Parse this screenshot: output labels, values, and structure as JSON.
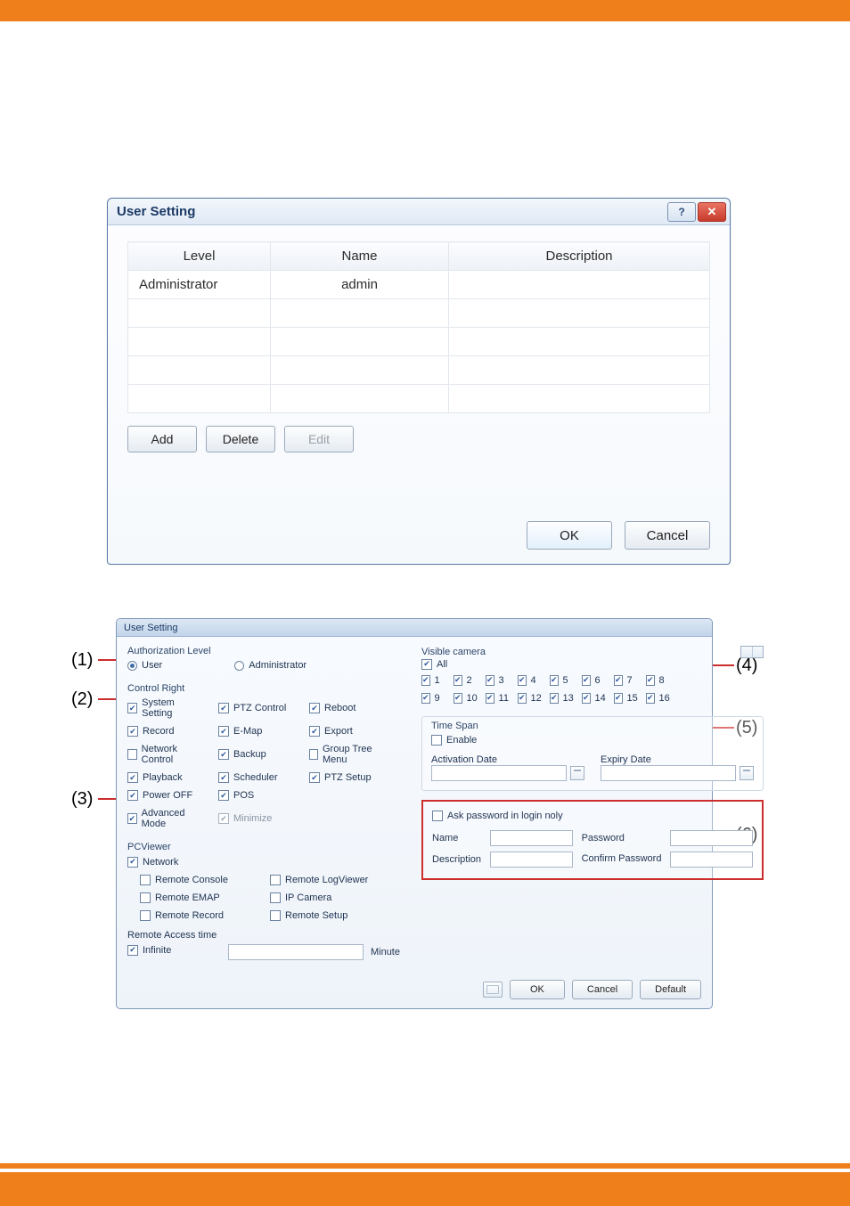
{
  "dialog1": {
    "title": "User Setting",
    "columns": {
      "level": "Level",
      "name": "Name",
      "description": "Description"
    },
    "rows": [
      {
        "level": "Administrator",
        "name": "admin",
        "description": ""
      }
    ],
    "buttons": {
      "add": "Add",
      "delete": "Delete",
      "edit": "Edit",
      "ok": "OK",
      "cancel": "Cancel"
    }
  },
  "dialog2": {
    "title": "User Setting",
    "authLevel": {
      "label": "Authorization Level",
      "user": "User",
      "admin": "Administrator",
      "selected": "user"
    },
    "controlRight": {
      "label": "Control Right",
      "items": [
        {
          "label": "System Setting",
          "checked": true
        },
        {
          "label": "PTZ Control",
          "checked": true
        },
        {
          "label": "Reboot",
          "checked": true
        },
        {
          "label": "Record",
          "checked": true
        },
        {
          "label": "E-Map",
          "checked": true
        },
        {
          "label": "Export",
          "checked": true
        },
        {
          "label": "Network Control",
          "checked": false
        },
        {
          "label": "Backup",
          "checked": true
        },
        {
          "label": "Group Tree Menu",
          "checked": false
        },
        {
          "label": "Playback",
          "checked": true
        },
        {
          "label": "Scheduler",
          "checked": true
        },
        {
          "label": "PTZ Setup",
          "checked": true
        },
        {
          "label": "Power OFF",
          "checked": true
        },
        {
          "label": "POS",
          "checked": true
        },
        {
          "label": "",
          "checked": null
        },
        {
          "label": "Advanced Mode",
          "checked": true
        },
        {
          "label": "Minimize",
          "checked": true,
          "dim": true
        }
      ]
    },
    "pcviewer": {
      "label": "PCViewer",
      "network": "Network",
      "items": [
        {
          "label": "Remote Console",
          "checked": false
        },
        {
          "label": "Remote LogViewer",
          "checked": false
        },
        {
          "label": "Remote EMAP",
          "checked": false
        },
        {
          "label": "IP Camera",
          "checked": false
        },
        {
          "label": "Remote Record",
          "checked": false
        },
        {
          "label": "Remote Setup",
          "checked": false
        }
      ],
      "accessTimeLabel": "Remote Access time",
      "infinite": "Infinite",
      "minuteLabel": "Minute",
      "minuteValue": ""
    },
    "visibleCamera": {
      "label": "Visible camera",
      "all": "All",
      "cams": [
        "1",
        "2",
        "3",
        "4",
        "5",
        "6",
        "7",
        "8",
        "9",
        "10",
        "11",
        "12",
        "13",
        "14",
        "15",
        "16"
      ]
    },
    "timespan": {
      "label": "Time Span",
      "enable": "Enable",
      "activation": "Activation Date",
      "expiry": "Expiry Date"
    },
    "cred": {
      "ask": "Ask password in login noly",
      "name": "Name",
      "description": "Description",
      "password": "Password",
      "confirm": "Confirm Password"
    },
    "footer": {
      "ok": "OK",
      "cancel": "Cancel",
      "default": "Default"
    }
  },
  "annotations": {
    "a1": "(1)",
    "a2": "(2)",
    "a3": "(3)",
    "a4": "(4)",
    "a5": "(5)",
    "a6": "(6)"
  }
}
